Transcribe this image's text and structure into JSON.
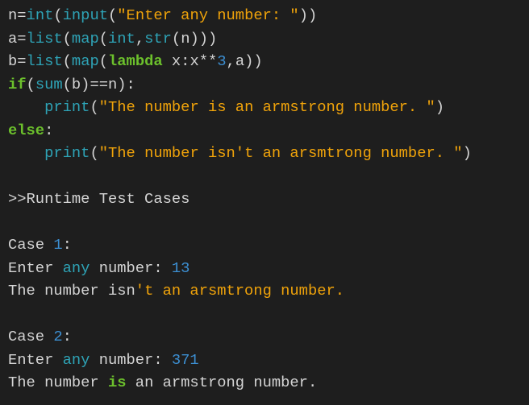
{
  "colors": {
    "default": "#d4d4d4",
    "builtin": "#2ea3b6",
    "string": "#f0a30a",
    "keyword": "#6cc02c",
    "number": "#3c8fd2",
    "background": "#1e1e1e"
  },
  "lines": [
    {
      "tokens": [
        {
          "t": "n=",
          "c": "d"
        },
        {
          "t": "int",
          "c": "b"
        },
        {
          "t": "(",
          "c": "d"
        },
        {
          "t": "input",
          "c": "b"
        },
        {
          "t": "(",
          "c": "d"
        },
        {
          "t": "\"Enter any number: \"",
          "c": "s"
        },
        {
          "t": "))",
          "c": "d"
        }
      ]
    },
    {
      "tokens": [
        {
          "t": "a=",
          "c": "d"
        },
        {
          "t": "list",
          "c": "b"
        },
        {
          "t": "(",
          "c": "d"
        },
        {
          "t": "map",
          "c": "b"
        },
        {
          "t": "(",
          "c": "d"
        },
        {
          "t": "int",
          "c": "b"
        },
        {
          "t": ",",
          "c": "d"
        },
        {
          "t": "str",
          "c": "b"
        },
        {
          "t": "(n)))",
          "c": "d"
        }
      ]
    },
    {
      "tokens": [
        {
          "t": "b=",
          "c": "d"
        },
        {
          "t": "list",
          "c": "b"
        },
        {
          "t": "(",
          "c": "d"
        },
        {
          "t": "map",
          "c": "b"
        },
        {
          "t": "(",
          "c": "d"
        },
        {
          "t": "lambda",
          "c": "k"
        },
        {
          "t": " x:x**",
          "c": "d"
        },
        {
          "t": "3",
          "c": "n"
        },
        {
          "t": ",a))",
          "c": "d"
        }
      ]
    },
    {
      "tokens": [
        {
          "t": "if",
          "c": "k"
        },
        {
          "t": "(",
          "c": "d"
        },
        {
          "t": "sum",
          "c": "b"
        },
        {
          "t": "(b)==n):",
          "c": "d"
        }
      ]
    },
    {
      "tokens": [
        {
          "t": "    ",
          "c": "d"
        },
        {
          "t": "print",
          "c": "b"
        },
        {
          "t": "(",
          "c": "d"
        },
        {
          "t": "\"The number is an armstrong number. \"",
          "c": "s"
        },
        {
          "t": ")",
          "c": "d"
        }
      ]
    },
    {
      "tokens": [
        {
          "t": "else",
          "c": "k"
        },
        {
          "t": ":",
          "c": "d"
        }
      ]
    },
    {
      "tokens": [
        {
          "t": "    ",
          "c": "d"
        },
        {
          "t": "print",
          "c": "b"
        },
        {
          "t": "(",
          "c": "d"
        },
        {
          "t": "\"The number isn't an arsmtrong number. \"",
          "c": "s"
        },
        {
          "t": ")",
          "c": "d"
        }
      ]
    },
    {
      "tokens": []
    },
    {
      "tokens": [
        {
          "t": ">>Runtime Test Cases",
          "c": "d"
        }
      ]
    },
    {
      "tokens": []
    },
    {
      "tokens": [
        {
          "t": "Case ",
          "c": "d"
        },
        {
          "t": "1",
          "c": "n"
        },
        {
          "t": ":",
          "c": "d"
        }
      ]
    },
    {
      "tokens": [
        {
          "t": "Enter ",
          "c": "d"
        },
        {
          "t": "any",
          "c": "b"
        },
        {
          "t": " number: ",
          "c": "d"
        },
        {
          "t": "13",
          "c": "n"
        }
      ]
    },
    {
      "tokens": [
        {
          "t": "The number isn",
          "c": "d"
        },
        {
          "t": "'t an arsmtrong number.",
          "c": "s"
        }
      ]
    },
    {
      "tokens": []
    },
    {
      "tokens": [
        {
          "t": "Case ",
          "c": "d"
        },
        {
          "t": "2",
          "c": "n"
        },
        {
          "t": ":",
          "c": "d"
        }
      ]
    },
    {
      "tokens": [
        {
          "t": "Enter ",
          "c": "d"
        },
        {
          "t": "any",
          "c": "b"
        },
        {
          "t": " number: ",
          "c": "d"
        },
        {
          "t": "371",
          "c": "n"
        }
      ]
    },
    {
      "tokens": [
        {
          "t": "The number ",
          "c": "d"
        },
        {
          "t": "is",
          "c": "k"
        },
        {
          "t": " an armstrong number.",
          "c": "d"
        }
      ]
    }
  ]
}
